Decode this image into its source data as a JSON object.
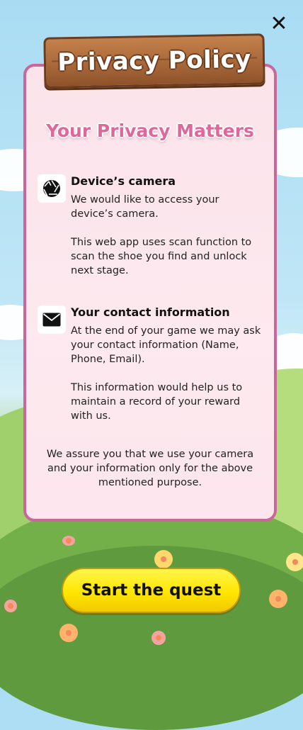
{
  "colors": {
    "card_border": "#c9679a",
    "card_fill": "#fbe3ea",
    "subtitle": "#e0679a",
    "sign_wood": "#a9683a",
    "cta": "#ffe600"
  },
  "header": {
    "close_icon": "close-icon",
    "close_glyph": "✕"
  },
  "sign": {
    "title": "Privacy Policy"
  },
  "card": {
    "subtitle": "Your Privacy Matters",
    "sections": [
      {
        "icon": "camera-aperture-icon",
        "title": "Device’s camera",
        "paragraphs": [
          "We would like to access your device’s camera.",
          "This web app uses scan function to scan the shoe you find and unlock next stage."
        ]
      },
      {
        "icon": "mail-icon",
        "title": "Your contact information",
        "paragraphs": [
          "At the end of your game we may ask your contact information (Name, Phone, Email).",
          "This information would help us to maintain a record of your reward with us."
        ]
      }
    ],
    "assurance": "We assure you that we use your camera and your information only for the above mentioned purpose."
  },
  "cta": {
    "label": "Start the quest"
  }
}
